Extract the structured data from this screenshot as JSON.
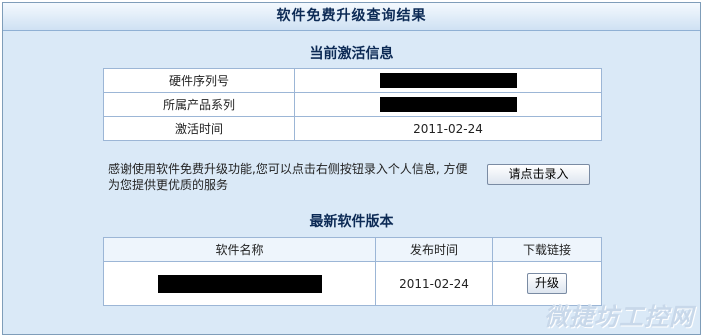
{
  "header": {
    "title": "软件免费升级查询结果"
  },
  "activation": {
    "title": "当前激活信息",
    "rows": [
      {
        "label": "硬件序列号",
        "value": ""
      },
      {
        "label": "所属产品系列",
        "value": ""
      },
      {
        "label": "激活时间",
        "value": "2011-02-24"
      }
    ]
  },
  "note": {
    "text": "感谢使用软件免费升级功能,您可以点击右侧按钮录入个人信息, 方便为您提供更优质的服务",
    "button_label": "请点击录入"
  },
  "latest": {
    "title": "最新软件版本",
    "headers": [
      "软件名称",
      "发布时间",
      "下载链接"
    ],
    "row": {
      "name": "",
      "date": "2011-02-24",
      "upgrade_label": "升级"
    }
  },
  "watermark": "微捷坊工控网"
}
